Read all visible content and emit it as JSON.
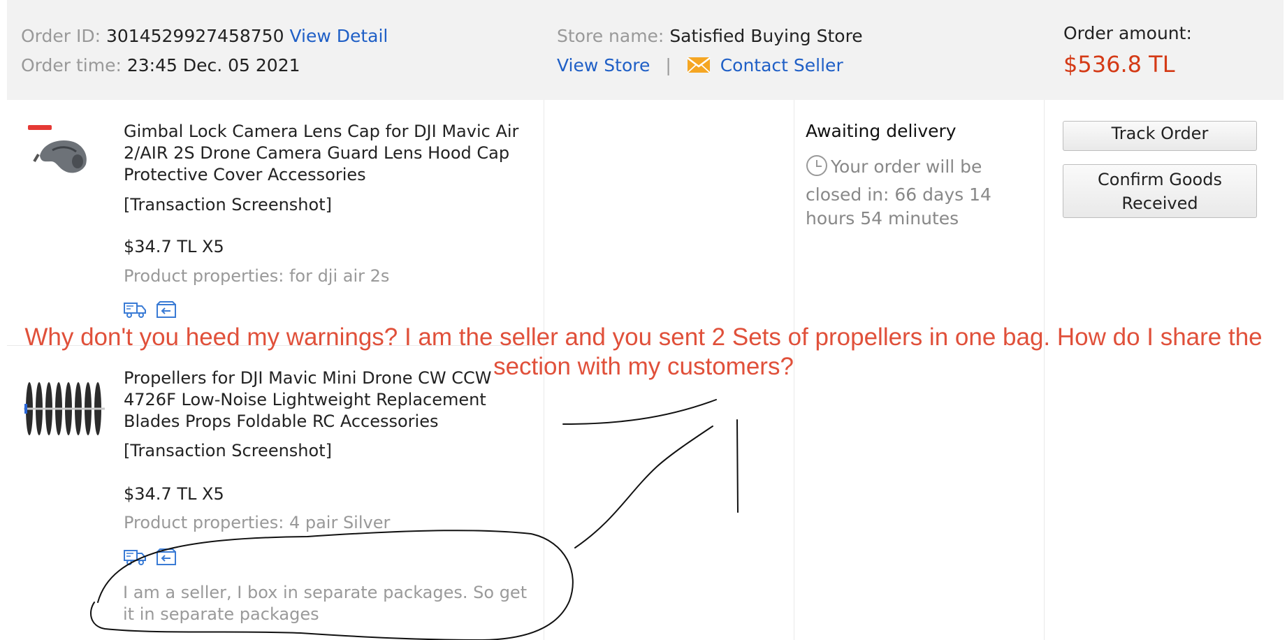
{
  "order": {
    "id_label": "Order ID:",
    "id_value": "3014529927458750",
    "view_detail": "View Detail",
    "time_label": "Order time:",
    "time_value": "23:45 Dec. 05 2021",
    "store_label": "Store name:",
    "store_value": "Satisfied Buying Store",
    "view_store": "View Store",
    "separator": "|",
    "contact_seller": "Contact Seller",
    "amount_label": "Order amount:",
    "amount_value": "$536.8 TL"
  },
  "status": {
    "title": "Awaiting delivery",
    "countdown": "Your order will be closed in: 66 days 14 hours 54 minutes"
  },
  "actions": {
    "track_order": "Track Order",
    "confirm_goods": "Confirm Goods Received"
  },
  "items": [
    {
      "title": "Gimbal Lock Camera Lens Cap for DJI Mavic Air 2/AIR 2S Drone Camera Guard Lens Hood Cap Protective Cover Accessories",
      "screenshot_link": "[Transaction Screenshot]",
      "price_qty": "$34.7 TL X5",
      "properties": "Product properties: for dji air 2s"
    },
    {
      "title": "Propellers for DJI Mavic Mini Drone CW CCW 4726F Low-Noise Lightweight Replacement Blades Props Foldable RC Accessories",
      "screenshot_link": "[Transaction Screenshot]",
      "price_qty": "$34.7 TL X5",
      "properties": "Product properties: 4 pair Silver"
    }
  ],
  "seller_note": "I am a seller, I box in separate packages. So get it in separate packages",
  "annotation": "Why don't you heed my warnings? I am the seller and you sent 2 Sets of propellers in one bag. How do I share the section with my customers?",
  "icons": {
    "shipping": "truck-icon",
    "return": "return-box-icon",
    "mail": "envelope-icon",
    "clock": "clock-icon"
  },
  "colors": {
    "link": "#1f5fc6",
    "amount": "#d43a16",
    "annotation": "#e0503a",
    "header_bg": "#f2f2f2",
    "envelope": "#f5a623"
  }
}
